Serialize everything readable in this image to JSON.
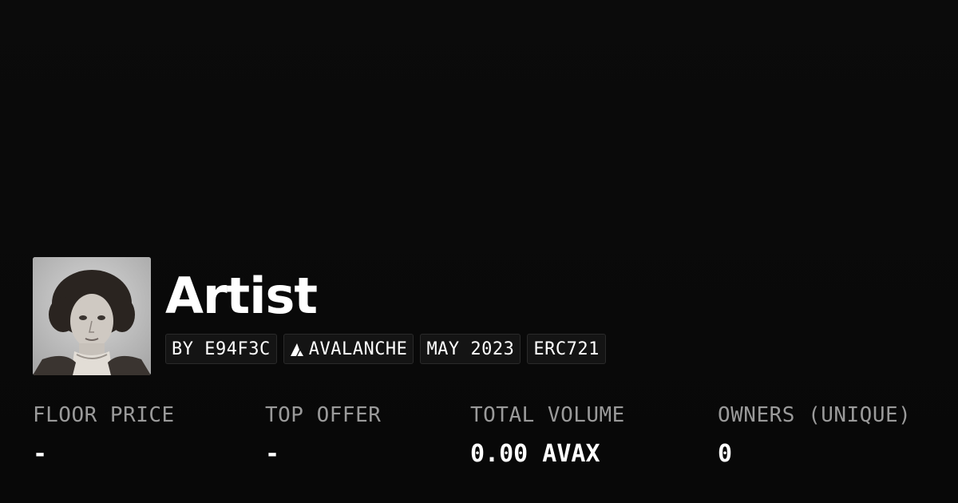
{
  "collection": {
    "title": "Artist",
    "avatar_alt": "Vintage portrait photograph",
    "tags": [
      {
        "label": "BY E94F3C",
        "icon": null
      },
      {
        "label": "AVALANCHE",
        "icon": "avalanche-logo-icon"
      },
      {
        "label": "MAY 2023",
        "icon": null
      },
      {
        "label": "ERC721",
        "icon": null
      }
    ]
  },
  "stats": [
    {
      "label": "FLOOR PRICE",
      "value": "-"
    },
    {
      "label": "TOP OFFER",
      "value": "-"
    },
    {
      "label": "TOTAL VOLUME",
      "value": "0.00 AVAX"
    },
    {
      "label": "OWNERS (UNIQUE)",
      "value": "0"
    }
  ],
  "colors": {
    "background": "#0a0a0a",
    "text": "#ffffff",
    "muted": "#9a9a9a",
    "tag_bg": "#141414",
    "tag_border": "#2a2a2a"
  }
}
